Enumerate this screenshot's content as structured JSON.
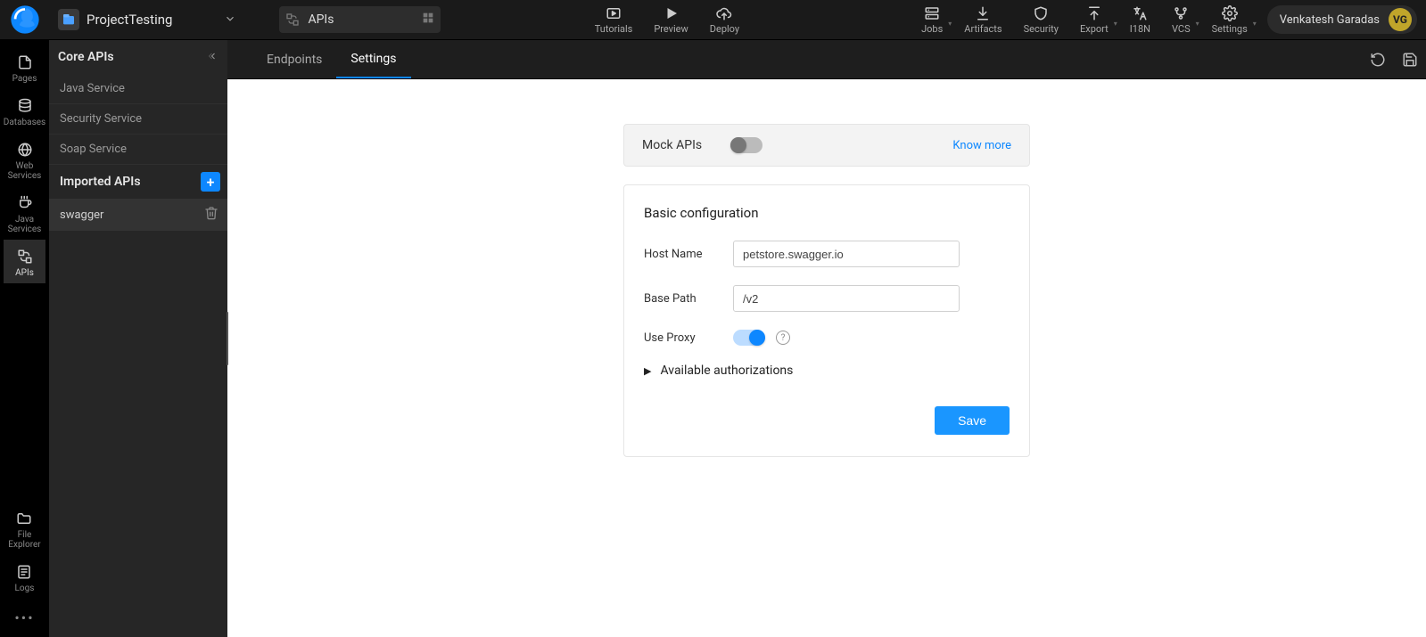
{
  "top": {
    "project_name": "ProjectTesting",
    "breadcrumb_label": "APIs",
    "actions_center": [
      {
        "icon": "play-box-icon",
        "label": "Tutorials"
      },
      {
        "icon": "play-icon",
        "label": "Preview"
      },
      {
        "icon": "cloud-deploy-icon",
        "label": "Deploy"
      }
    ],
    "actions_right": [
      {
        "icon": "server-icon",
        "label": "Jobs",
        "chev": true
      },
      {
        "icon": "download-icon",
        "label": "Artifacts"
      },
      {
        "icon": "shield-icon",
        "label": "Security"
      },
      {
        "icon": "upload-icon",
        "label": "Export",
        "chev": true
      },
      {
        "icon": "translate-icon",
        "label": "I18N"
      },
      {
        "icon": "branch-icon",
        "label": "VCS",
        "chev": true
      },
      {
        "icon": "gear-icon",
        "label": "Settings",
        "chev": true
      }
    ],
    "user_name": "Venkatesh Garadas",
    "user_initials": "VG"
  },
  "rail": {
    "items": [
      {
        "id": "pages",
        "label": "Pages"
      },
      {
        "id": "databases",
        "label": "Databases"
      },
      {
        "id": "web-services",
        "label": "Web\nServices"
      },
      {
        "id": "java-services",
        "label": "Java\nServices"
      },
      {
        "id": "apis",
        "label": "APIs",
        "active": true
      }
    ],
    "bottom": [
      {
        "id": "file-explorer",
        "label": "File\nExplorer"
      },
      {
        "id": "logs",
        "label": "Logs"
      }
    ]
  },
  "side": {
    "section1_title": "Core APIs",
    "core_items": [
      "Java Service",
      "Security Service",
      "Soap Service"
    ],
    "section2_title": "Imported APIs",
    "imported_items": [
      "swagger"
    ]
  },
  "tabs": {
    "items": [
      "Endpoints",
      "Settings"
    ],
    "active_index": 1
  },
  "settings": {
    "mock_label": "Mock APIs",
    "mock_on": false,
    "know_more": "Know more",
    "basic_title": "Basic configuration",
    "host_label": "Host Name",
    "host_value": "petstore.swagger.io",
    "path_label": "Base Path",
    "path_value": "/v2",
    "proxy_label": "Use Proxy",
    "proxy_on": true,
    "auth_label": "Available authorizations",
    "save_label": "Save"
  }
}
